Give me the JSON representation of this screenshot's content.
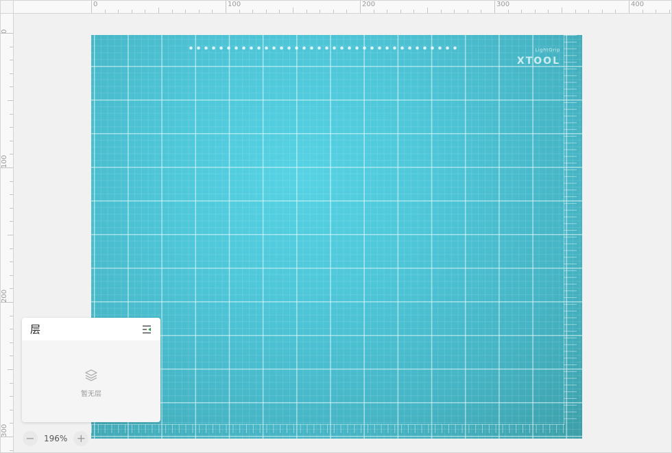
{
  "ruler": {
    "top_labels": [
      "0",
      "100",
      "200",
      "300",
      "400"
    ],
    "left_labels": [
      "0",
      "100",
      "200",
      "300"
    ]
  },
  "workspace": {
    "background_preview": {
      "brand_sub": "LightGrip",
      "brand": "XTOOL",
      "color": "#4ec6d8"
    }
  },
  "layers_panel": {
    "title": "层",
    "collapse_icon": "collapse-panel-icon",
    "empty_icon": "layers-icon",
    "empty_text": "暂无层"
  },
  "zoom": {
    "value": "196%",
    "minus_label": "−",
    "plus_label": "+"
  },
  "colors": {
    "accent": "#2e9b4e",
    "canvas_bg": "#f1f1f1"
  }
}
